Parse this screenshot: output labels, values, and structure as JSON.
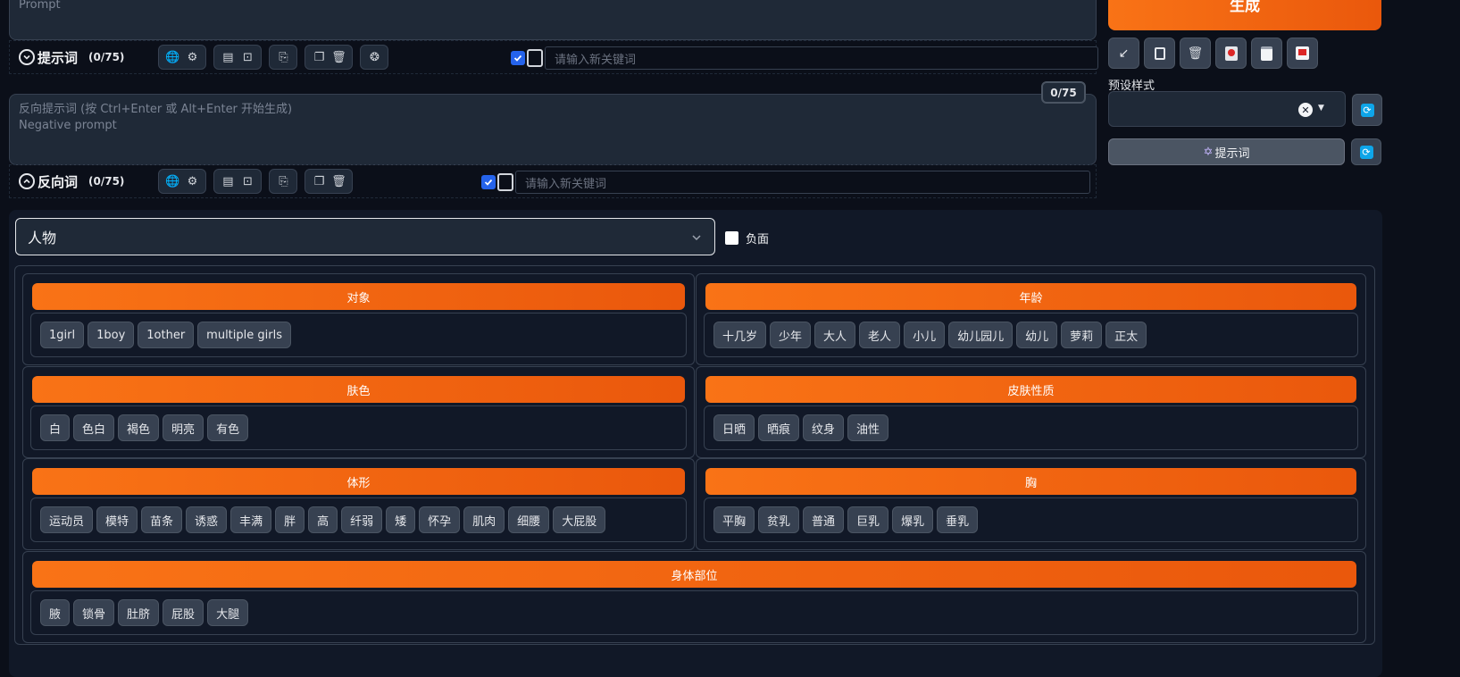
{
  "prompt": {
    "placeholder": "Prompt",
    "title": "提示词",
    "count": "(0/75)",
    "keyword_placeholder": "请输入新关键词"
  },
  "negative": {
    "placeholder_line1": "反向提示词 (按 Ctrl+Enter 或 Alt+Enter 开始生成)",
    "placeholder_line2": "Negative prompt",
    "badge": "0/75",
    "title": "反向词",
    "count": "(0/75)",
    "keyword_placeholder": "请输入新关键词"
  },
  "right": {
    "generate_label": "生成",
    "styles_label": "预设样式",
    "prompt_button": "提示词",
    "prompt_button_icon": "✡"
  },
  "category": {
    "selected": "人物",
    "negative_label": "负面"
  },
  "sections": [
    {
      "title": "对象",
      "tags": [
        "1girl",
        "1boy",
        "1other",
        "multiple girls"
      ]
    },
    {
      "title": "年龄",
      "tags": [
        "十几岁",
        "少年",
        "大人",
        "老人",
        "小儿",
        "幼儿园儿",
        "幼儿",
        "萝莉",
        "正太"
      ]
    },
    {
      "title": "肤色",
      "tags": [
        "白",
        "色白",
        "褐色",
        "明亮",
        "有色"
      ]
    },
    {
      "title": "皮肤性质",
      "tags": [
        "日晒",
        "晒痕",
        "纹身",
        "油性"
      ]
    },
    {
      "title": "体形",
      "tags": [
        "运动员",
        "模特",
        "苗条",
        "诱惑",
        "丰满",
        "胖",
        "高",
        "纤弱",
        "矮",
        "怀孕",
        "肌肉",
        "细腰",
        "大屁股"
      ]
    },
    {
      "title": "胸",
      "tags": [
        "平胸",
        "贫乳",
        "普通",
        "巨乳",
        "爆乳",
        "垂乳"
      ]
    },
    {
      "title": "身体部位",
      "tags": [
        "腋",
        "锁骨",
        "肚脐",
        "屁股",
        "大腿"
      ]
    }
  ],
  "colors": {
    "accent": "#f97316",
    "checkbox": "#2563eb",
    "background": "#0b0f19"
  }
}
